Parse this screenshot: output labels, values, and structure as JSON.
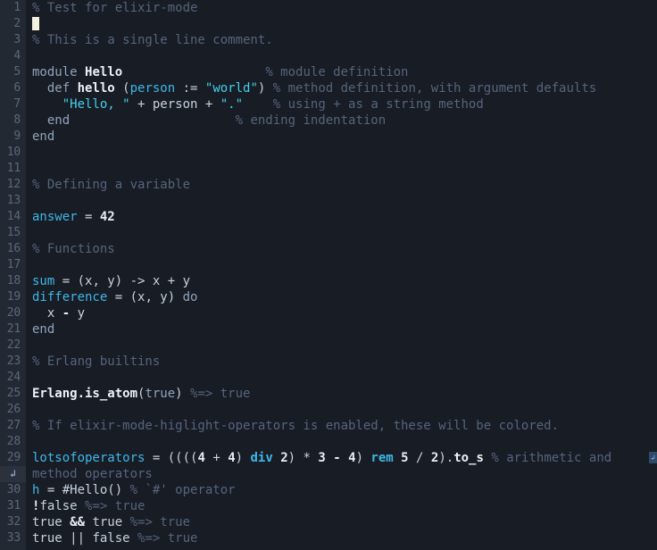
{
  "editor": {
    "app": "emacs-elixir-mode",
    "filetype": "elixir",
    "theme": "dark-navy",
    "colors": {
      "background": "#181c25",
      "gutter_background": "#232933",
      "gutter_continuation_background": "#2b323d",
      "line_number": "#5b677a",
      "default_text": "#c8d3e0",
      "comment": "#55657c",
      "string": "#43d2ec",
      "variable": "#3fb8e8",
      "function_name": "#eef2f8",
      "keyword": "#8fa4bd",
      "cursor": "#f3f0df"
    },
    "cursor": {
      "line": 2,
      "column": 1,
      "shape": "block"
    },
    "total_visible_lines": 33,
    "wrap_indicator_glyph": "↲"
  },
  "lines": [
    {
      "n": "1",
      "tokens": [
        {
          "t": "% Test for elixir-mode",
          "c": "cmt"
        }
      ]
    },
    {
      "n": "2",
      "tokens": [
        {
          "t": "",
          "c": "cursor"
        }
      ]
    },
    {
      "n": "3",
      "tokens": [
        {
          "t": "% This is a single line comment.",
          "c": "cmt"
        }
      ]
    },
    {
      "n": "4",
      "tokens": []
    },
    {
      "n": "5",
      "tokens": [
        {
          "t": "module ",
          "c": "kw"
        },
        {
          "t": "Hello",
          "c": "fn"
        },
        {
          "t": "                   ",
          "c": "pl"
        },
        {
          "t": "% module definition",
          "c": "cmt"
        }
      ]
    },
    {
      "n": "6",
      "tokens": [
        {
          "t": "  ",
          "c": "pl"
        },
        {
          "t": "def ",
          "c": "kw"
        },
        {
          "t": "hello",
          "c": "fn"
        },
        {
          "t": " (",
          "c": "pl"
        },
        {
          "t": "person",
          "c": "parm"
        },
        {
          "t": " := ",
          "c": "pl"
        },
        {
          "t": "\"world\"",
          "c": "str"
        },
        {
          "t": ") ",
          "c": "pl"
        },
        {
          "t": "% method definition, with argument defaults",
          "c": "cmt"
        }
      ]
    },
    {
      "n": "7",
      "tokens": [
        {
          "t": "    ",
          "c": "pl"
        },
        {
          "t": "\"Hello, \"",
          "c": "str"
        },
        {
          "t": " + ",
          "c": "pl"
        },
        {
          "t": "person",
          "c": "pl"
        },
        {
          "t": " + ",
          "c": "pl"
        },
        {
          "t": "\".\"",
          "c": "str"
        },
        {
          "t": "    ",
          "c": "pl"
        },
        {
          "t": "% using + as a string method",
          "c": "cmt"
        }
      ]
    },
    {
      "n": "8",
      "tokens": [
        {
          "t": "  ",
          "c": "pl"
        },
        {
          "t": "end",
          "c": "kw"
        },
        {
          "t": "                      ",
          "c": "pl"
        },
        {
          "t": "% ending indentation",
          "c": "cmt"
        }
      ]
    },
    {
      "n": "9",
      "tokens": [
        {
          "t": "end",
          "c": "kw"
        }
      ]
    },
    {
      "n": "10",
      "tokens": []
    },
    {
      "n": "11",
      "tokens": []
    },
    {
      "n": "12",
      "tokens": [
        {
          "t": "% Defining a variable",
          "c": "cmt"
        }
      ]
    },
    {
      "n": "13",
      "tokens": []
    },
    {
      "n": "14",
      "tokens": [
        {
          "t": "answer",
          "c": "var"
        },
        {
          "t": " = ",
          "c": "pl"
        },
        {
          "t": "42",
          "c": "num"
        }
      ]
    },
    {
      "n": "15",
      "tokens": []
    },
    {
      "n": "16",
      "tokens": [
        {
          "t": "% Functions",
          "c": "cmt"
        }
      ]
    },
    {
      "n": "17",
      "tokens": []
    },
    {
      "n": "18",
      "tokens": [
        {
          "t": "sum",
          "c": "var"
        },
        {
          "t": " = (x, y) -> x + y",
          "c": "pl"
        }
      ]
    },
    {
      "n": "19",
      "tokens": [
        {
          "t": "difference",
          "c": "var"
        },
        {
          "t": " = (x, y) ",
          "c": "pl"
        },
        {
          "t": "do",
          "c": "kw"
        }
      ]
    },
    {
      "n": "20",
      "tokens": [
        {
          "t": "  x ",
          "c": "pl"
        },
        {
          "t": "-",
          "c": "op"
        },
        {
          "t": " y",
          "c": "pl"
        }
      ]
    },
    {
      "n": "21",
      "tokens": [
        {
          "t": "end",
          "c": "kw"
        }
      ]
    },
    {
      "n": "22",
      "tokens": []
    },
    {
      "n": "23",
      "tokens": [
        {
          "t": "% Erlang builtins",
          "c": "cmt"
        }
      ]
    },
    {
      "n": "24",
      "tokens": []
    },
    {
      "n": "25",
      "tokens": [
        {
          "t": "Erlang.is_atom",
          "c": "bi"
        },
        {
          "t": "(",
          "c": "pl"
        },
        {
          "t": "true",
          "c": "lit"
        },
        {
          "t": ") ",
          "c": "pl"
        },
        {
          "t": "%=> true",
          "c": "cmt"
        }
      ]
    },
    {
      "n": "26",
      "tokens": []
    },
    {
      "n": "27",
      "tokens": [
        {
          "t": "% If elixir-mode-higlight-operators is enabled, these will be colored.",
          "c": "cmt"
        }
      ]
    },
    {
      "n": "28",
      "tokens": []
    },
    {
      "n": "29",
      "tokens": [
        {
          "t": "lotsofoperators",
          "c": "var"
        },
        {
          "t": " = ((((",
          "c": "pl"
        },
        {
          "t": "4",
          "c": "num"
        },
        {
          "t": " + ",
          "c": "pl"
        },
        {
          "t": "4",
          "c": "num"
        },
        {
          "t": ") ",
          "c": "pl"
        },
        {
          "t": "div",
          "c": "opk"
        },
        {
          "t": " ",
          "c": "pl"
        },
        {
          "t": "2",
          "c": "num"
        },
        {
          "t": ") * ",
          "c": "pl"
        },
        {
          "t": "3",
          "c": "num"
        },
        {
          "t": " ",
          "c": "pl"
        },
        {
          "t": "-",
          "c": "op"
        },
        {
          "t": " ",
          "c": "pl"
        },
        {
          "t": "4",
          "c": "num"
        },
        {
          "t": ") ",
          "c": "pl"
        },
        {
          "t": "rem",
          "c": "opk"
        },
        {
          "t": " ",
          "c": "pl"
        },
        {
          "t": "5",
          "c": "num"
        },
        {
          "t": " / ",
          "c": "pl"
        },
        {
          "t": "2",
          "c": "num"
        },
        {
          "t": ").",
          "c": "pl"
        },
        {
          "t": "to_s",
          "c": "bi"
        },
        {
          "t": " ",
          "c": "pl"
        },
        {
          "t": "% arithmetic and",
          "c": "cmt"
        }
      ],
      "wrapped": true
    },
    {
      "n": "↲",
      "continuation": true,
      "tokens": [
        {
          "t": "method operators",
          "c": "cmt"
        }
      ]
    },
    {
      "n": "30",
      "tokens": [
        {
          "t": "h",
          "c": "var"
        },
        {
          "t": " = #Hello() ",
          "c": "pl"
        },
        {
          "t": "% `#' operator",
          "c": "cmt"
        }
      ]
    },
    {
      "n": "31",
      "tokens": [
        {
          "t": "!",
          "c": "op"
        },
        {
          "t": "false",
          "c": "pl"
        },
        {
          "t": " ",
          "c": "pl"
        },
        {
          "t": "%=> true",
          "c": "cmt"
        }
      ]
    },
    {
      "n": "32",
      "tokens": [
        {
          "t": "true ",
          "c": "pl"
        },
        {
          "t": "&&",
          "c": "op"
        },
        {
          "t": " true ",
          "c": "pl"
        },
        {
          "t": "%=> true",
          "c": "cmt"
        }
      ]
    },
    {
      "n": "33",
      "tokens": [
        {
          "t": "true ",
          "c": "pl"
        },
        {
          "t": "||",
          "c": "pl"
        },
        {
          "t": " false ",
          "c": "pl"
        },
        {
          "t": "%=> true",
          "c": "cmt"
        }
      ]
    }
  ]
}
